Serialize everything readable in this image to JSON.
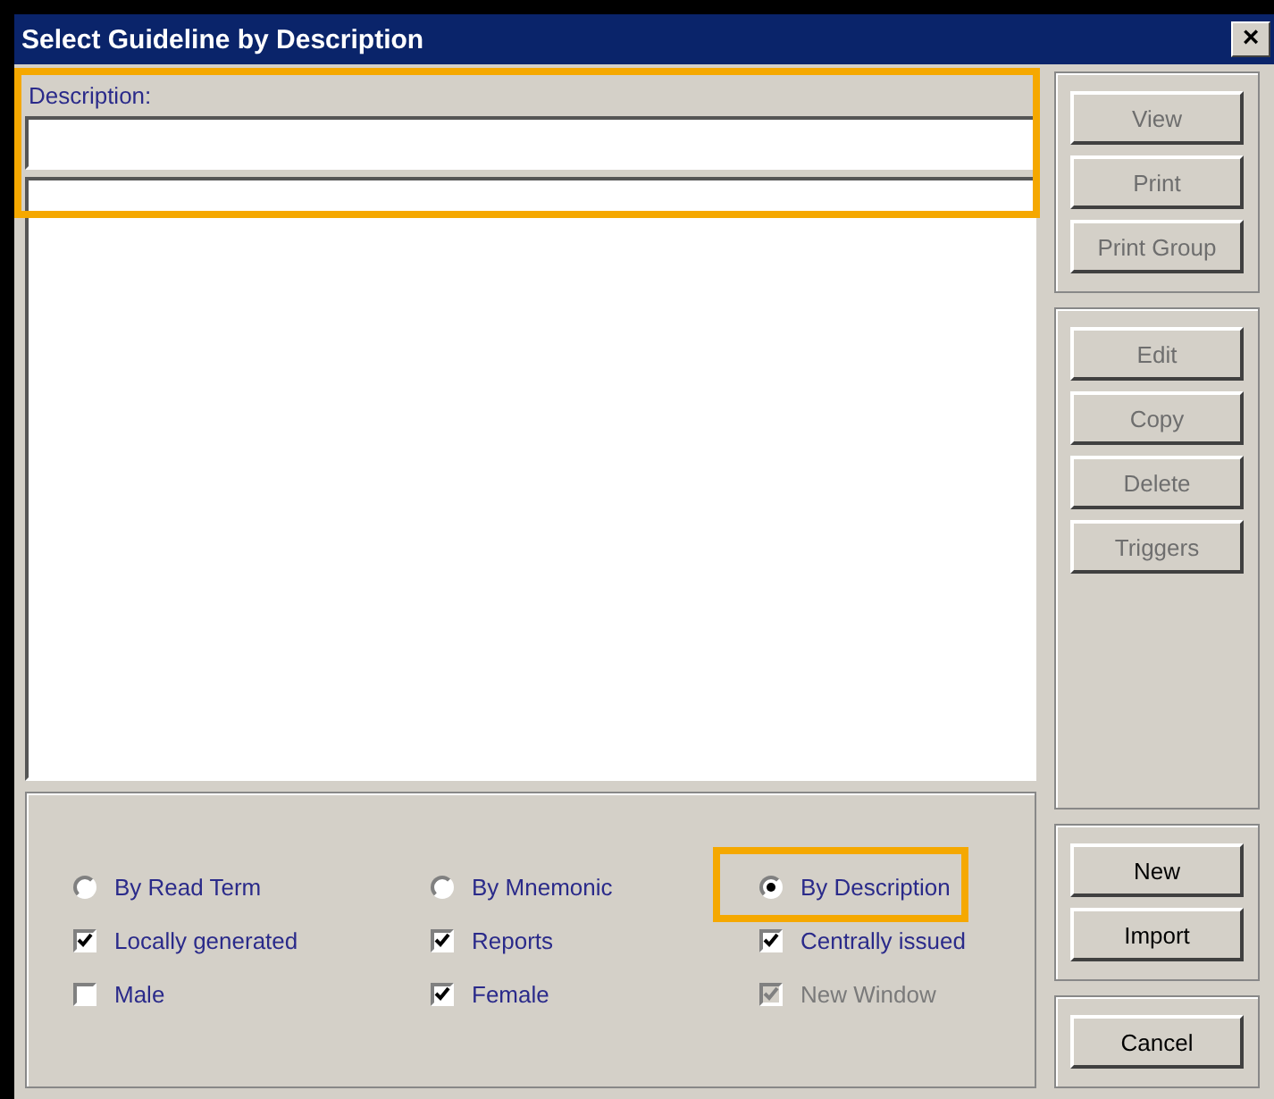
{
  "window": {
    "title": "Select Guideline by Description",
    "close": "×"
  },
  "description": {
    "label": "Description:",
    "highlighted": true
  },
  "button_groups": [
    [
      {
        "label": "View",
        "disabled": true
      },
      {
        "label": "Print",
        "disabled": true
      },
      {
        "label": "Print Group",
        "disabled": true
      }
    ],
    [
      {
        "label": "Edit",
        "disabled": true
      },
      {
        "label": "Copy",
        "disabled": true
      },
      {
        "label": "Delete",
        "disabled": true
      },
      {
        "label": "Triggers",
        "disabled": true
      }
    ],
    [
      {
        "label": "New",
        "disabled": false
      },
      {
        "label": "Import",
        "disabled": false
      }
    ],
    [
      {
        "label": "Cancel",
        "disabled": false
      }
    ]
  ],
  "options": [
    {
      "kind": "radio",
      "label": "By Read Term",
      "selected": false,
      "highlighted": false
    },
    {
      "kind": "radio",
      "label": "By Mnemonic",
      "selected": false,
      "highlighted": false
    },
    {
      "kind": "radio",
      "label": "By Description",
      "selected": true,
      "highlighted": true
    },
    {
      "kind": "checkbox",
      "label": "Locally generated",
      "checked": true,
      "disabled": false
    },
    {
      "kind": "checkbox",
      "label": "Reports",
      "checked": true,
      "disabled": false
    },
    {
      "kind": "checkbox",
      "label": "Centrally issued",
      "checked": true,
      "disabled": false
    },
    {
      "kind": "checkbox",
      "label": "Male",
      "checked": false,
      "disabled": false
    },
    {
      "kind": "checkbox",
      "label": "Female",
      "checked": true,
      "disabled": false
    },
    {
      "kind": "checkbox",
      "label": "New Window",
      "checked": true,
      "disabled": true
    }
  ]
}
